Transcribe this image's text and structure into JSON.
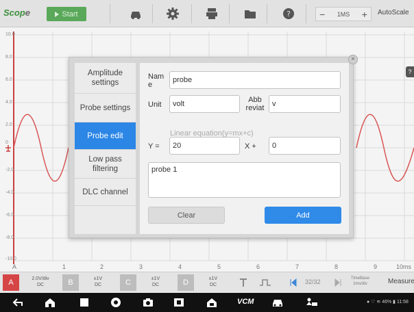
{
  "toolbar": {
    "logo_main": "Scop",
    "logo_tail": "e",
    "start_label": "Start",
    "timebase_value": "1MS",
    "autoscale_label": "AutoScale"
  },
  "scope": {
    "y_labels": [
      "10.0",
      "8.0",
      "6.0",
      "4.0",
      "2.0",
      "0",
      "-2.0",
      "-4.0",
      "-6.0",
      "-8.0",
      "-10.0"
    ],
    "x_labels": [
      "A",
      "1",
      "2",
      "3",
      "4",
      "5",
      "6",
      "7",
      "8",
      "9",
      "10ms"
    ]
  },
  "channels": [
    {
      "letter": "A",
      "scale": "2.0V/div",
      "coupling": "DC",
      "color": "#d64545"
    },
    {
      "letter": "B",
      "scale": "±1V",
      "coupling": "DC",
      "color": "#bdbdbd"
    },
    {
      "letter": "C",
      "scale": "±1V",
      "coupling": "DC",
      "color": "#bdbdbd"
    },
    {
      "letter": "D",
      "scale": "±1V",
      "coupling": "DC",
      "color": "#bdbdbd"
    }
  ],
  "chbar": {
    "page": "32/32",
    "timebase_line1": "TimeBase",
    "timebase_line2": "1ms/div",
    "measure_label": "Measure"
  },
  "navbar": {
    "vcm_label": "VCM",
    "status_text": "● ♡ ≋ 46% ▮ 11:58"
  },
  "dialog": {
    "close_glyph": "×",
    "menu": [
      "Amplitude settings",
      "Probe settings",
      "Probe edit",
      "Low pass filtering",
      "DLC channel"
    ],
    "active_index": 2,
    "form": {
      "name_label": "Nam e",
      "name_value": "probe",
      "unit_label": "Unit",
      "unit_value": "volt",
      "abbr_label": "Abb reviat",
      "abbr_value": "v",
      "equation_hint": "Linear equation(y=mx+c)",
      "y_label": "Y =",
      "m_value": "20",
      "x_label": "X +",
      "c_value": "0",
      "description_value": "probe 1",
      "clear_label": "Clear",
      "add_label": "Add"
    }
  },
  "help_glyph": "?"
}
